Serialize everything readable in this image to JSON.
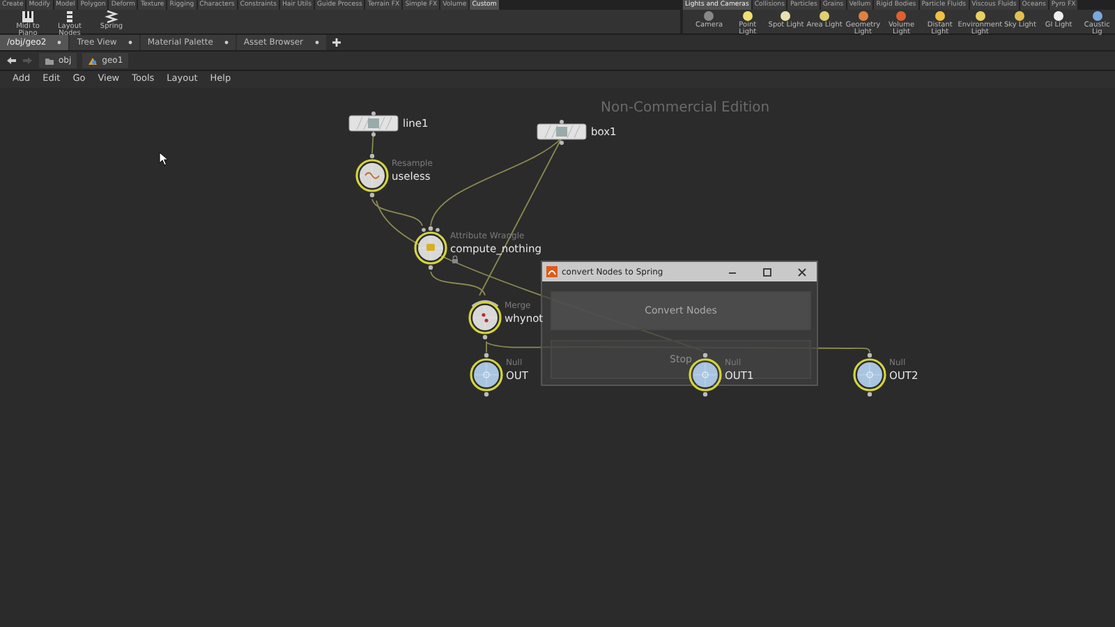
{
  "shelf_left": {
    "tabs": [
      {
        "label": "Create",
        "selected": false
      },
      {
        "label": "Modify",
        "selected": false
      },
      {
        "label": "Model",
        "selected": false
      },
      {
        "label": "Polygon",
        "selected": false
      },
      {
        "label": "Deform",
        "selected": false
      },
      {
        "label": "Texture",
        "selected": false
      },
      {
        "label": "Rigging",
        "selected": false
      },
      {
        "label": "Characters",
        "selected": false
      },
      {
        "label": "Constraints",
        "selected": false
      },
      {
        "label": "Hair Utils",
        "selected": false
      },
      {
        "label": "Guide Process",
        "selected": false
      },
      {
        "label": "Terrain FX",
        "selected": false
      },
      {
        "label": "Simple FX",
        "selected": false
      },
      {
        "label": "Volume",
        "selected": false
      },
      {
        "label": "Custom",
        "selected": true
      }
    ],
    "tools": [
      {
        "label": "Midi to Piano"
      },
      {
        "label": "Layout Nodes"
      },
      {
        "label": "Spring"
      }
    ]
  },
  "shelf_right": {
    "tabs": [
      {
        "label": "Lights and Cameras",
        "selected": true
      },
      {
        "label": "Collisions",
        "selected": false
      },
      {
        "label": "Particles",
        "selected": false
      },
      {
        "label": "Grains",
        "selected": false
      },
      {
        "label": "Vellum",
        "selected": false
      },
      {
        "label": "Rigid Bodies",
        "selected": false
      },
      {
        "label": "Particle Fluids",
        "selected": false
      },
      {
        "label": "Viscous Fluids",
        "selected": false
      },
      {
        "label": "Oceans",
        "selected": false
      },
      {
        "label": "Pyro FX",
        "selected": false
      }
    ],
    "tools": [
      {
        "label": "Camera"
      },
      {
        "label": "Point Light"
      },
      {
        "label": "Spot Light"
      },
      {
        "label": "Area Light"
      },
      {
        "label": "Geometry Light"
      },
      {
        "label": "Volume Light"
      },
      {
        "label": "Distant Light"
      },
      {
        "label": "Environment Light"
      },
      {
        "label": "Sky Light"
      },
      {
        "label": "GI Light"
      },
      {
        "label": "Caustic Lig"
      }
    ]
  },
  "pane_tabs": [
    {
      "label": "/obj/geo2",
      "selected": true
    },
    {
      "label": "Tree View",
      "selected": false
    },
    {
      "label": "Material Palette",
      "selected": false
    },
    {
      "label": "Asset Browser",
      "selected": false
    }
  ],
  "path_bar": {
    "forward_disabled": true,
    "segments": [
      "obj",
      "geo1"
    ]
  },
  "menu": [
    "Add",
    "Edit",
    "Go",
    "View",
    "Tools",
    "Layout",
    "Help"
  ],
  "network": {
    "edition_label": "Non-Commercial Edition",
    "nodes": [
      {
        "kind": "tile",
        "name": "line1"
      },
      {
        "kind": "tile",
        "name": "box1"
      },
      {
        "kind": "resample",
        "type_label": "Resample",
        "name": "useless"
      },
      {
        "kind": "wrangle",
        "type_label": "Attribute Wrangle",
        "name": "compute_nothing",
        "locked": true
      },
      {
        "kind": "merge",
        "type_label": "Merge",
        "name": "whynot"
      },
      {
        "kind": "null",
        "type_label": "Null",
        "name": "OUT"
      },
      {
        "kind": "null",
        "type_label": "Null",
        "name": "OUT1"
      },
      {
        "kind": "null",
        "type_label": "Null",
        "name": "OUT2"
      }
    ]
  },
  "dialog": {
    "title": "convert Nodes to Spring",
    "buttons": [
      {
        "label": "Convert Nodes",
        "disabled": false
      },
      {
        "label": "Stop",
        "disabled": true
      }
    ]
  }
}
